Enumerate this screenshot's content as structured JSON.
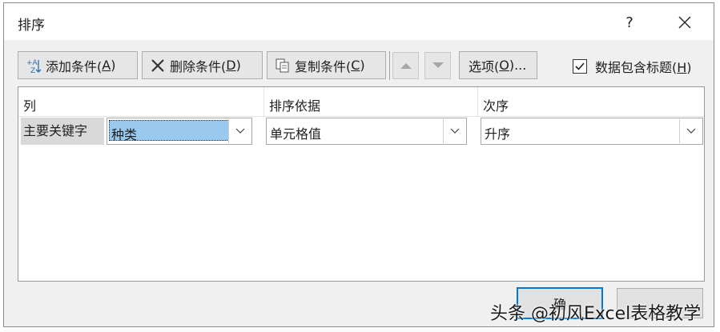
{
  "dialog": {
    "title": "排序",
    "help": "?",
    "close_icon": "close-icon"
  },
  "toolbar": {
    "add": {
      "text": "添加条件(",
      "key": "A",
      "end": ")",
      "icon": "add-sort-level-icon"
    },
    "delete": {
      "text": "删除条件(",
      "key": "D",
      "end": ")",
      "icon": "delete-x-icon"
    },
    "copy": {
      "text": "复制条件(",
      "key": "C",
      "end": ")",
      "icon": "copy-icon"
    },
    "move_up_icon": "arrow-up-icon",
    "move_down_icon": "arrow-down-icon",
    "options": {
      "text": "选项(",
      "key": "O",
      "end": ")..."
    }
  },
  "header_checkbox": {
    "text": "数据包含标题(",
    "key": "H",
    "end": ")",
    "checked": true
  },
  "columns": {
    "col": "列",
    "sort_on": "排序依据",
    "order": "次序"
  },
  "rows": [
    {
      "label": "主要关键字",
      "column": "种类",
      "sort_on": "单元格值",
      "order": "升序"
    }
  ],
  "buttons": {
    "ok_partial": "确",
    "cancel_partial": ""
  },
  "watermark": {
    "text": "头条 @初风Excel表格教学"
  },
  "colors": {
    "accent": "#0078d7",
    "selection": "#99c9ef"
  }
}
